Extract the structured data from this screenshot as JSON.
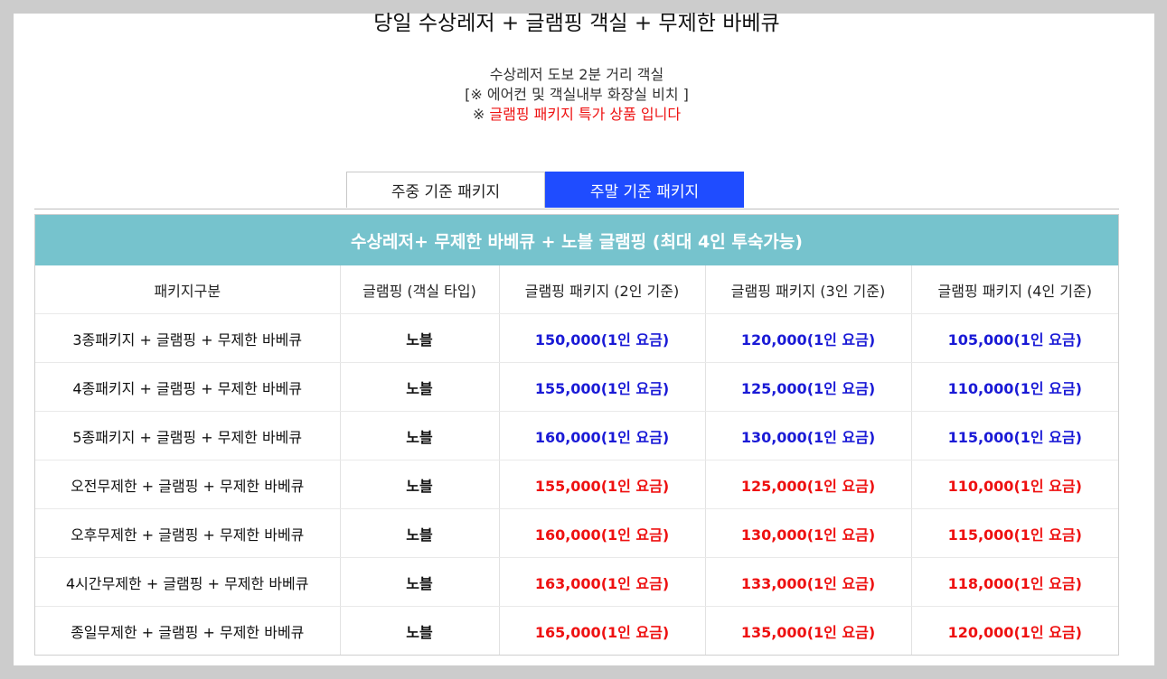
{
  "header": {
    "title": "당일 수상레저 + 글램핑 객실 + 무제한 바베큐",
    "line1": "수상레저 도보 2분 거리 객실",
    "line2": "[※ 에어컨 및 객실내부 화장실 비치 ]",
    "line3_symbol": "※",
    "line3": "글램핑 패키지 특가 상품 입니다"
  },
  "tabs": [
    {
      "label": "주중 기준 패키지",
      "active": false
    },
    {
      "label": "주말 기준 패키지",
      "active": true
    }
  ],
  "table": {
    "title": "수상레저+ 무제한 바베큐 + 노블 글램핑 (최대 4인 투숙가능)",
    "headers": [
      "패키지구분",
      "글램핑 (객실 타입)",
      "글램핑 패키지 (2인 기준)",
      "글램핑 패키지 (3인 기준)",
      "글램핑 패키지 (4인 기준)"
    ],
    "rows": [
      {
        "package": "3종패키지 + 글램핑 + 무제한 바베큐",
        "room": "노블",
        "p2": "150,000(1인 요금)",
        "p3": "120,000(1인 요금)",
        "p4": "105,000(1인 요금)",
        "color": "blue"
      },
      {
        "package": "4종패키지 + 글램핑 + 무제한 바베큐",
        "room": "노블",
        "p2": "155,000(1인 요금)",
        "p3": "125,000(1인 요금)",
        "p4": "110,000(1인 요금)",
        "color": "blue"
      },
      {
        "package": "5종패키지 + 글램핑 + 무제한 바베큐",
        "room": "노블",
        "p2": "160,000(1인 요금)",
        "p3": "130,000(1인 요금)",
        "p4": "115,000(1인 요금)",
        "color": "blue"
      },
      {
        "package": "오전무제한 + 글램핑 + 무제한 바베큐",
        "room": "노블",
        "p2": "155,000(1인 요금)",
        "p3": "125,000(1인 요금)",
        "p4": "110,000(1인 요금)",
        "color": "red"
      },
      {
        "package": "오후무제한 + 글램핑 + 무제한 바베큐",
        "room": "노블",
        "p2": "160,000(1인 요금)",
        "p3": "130,000(1인 요금)",
        "p4": "115,000(1인 요금)",
        "color": "red"
      },
      {
        "package": "4시간무제한 + 글램핑 + 무제한 바베큐",
        "room": "노블",
        "p2": "163,000(1인 요금)",
        "p3": "133,000(1인 요금)",
        "p4": "118,000(1인 요금)",
        "color": "red"
      },
      {
        "package": "종일무제한 + 글램핑 + 무제한 바베큐",
        "room": "노블",
        "p2": "165,000(1인 요금)",
        "p3": "135,000(1인 요금)",
        "p4": "120,000(1인 요금)",
        "color": "red"
      }
    ]
  },
  "colors": {
    "tab_active": "#1f4cff",
    "table_title_bg": "#76c3cd",
    "price_blue": "#1a1ad6",
    "price_red": "#ee1111"
  }
}
